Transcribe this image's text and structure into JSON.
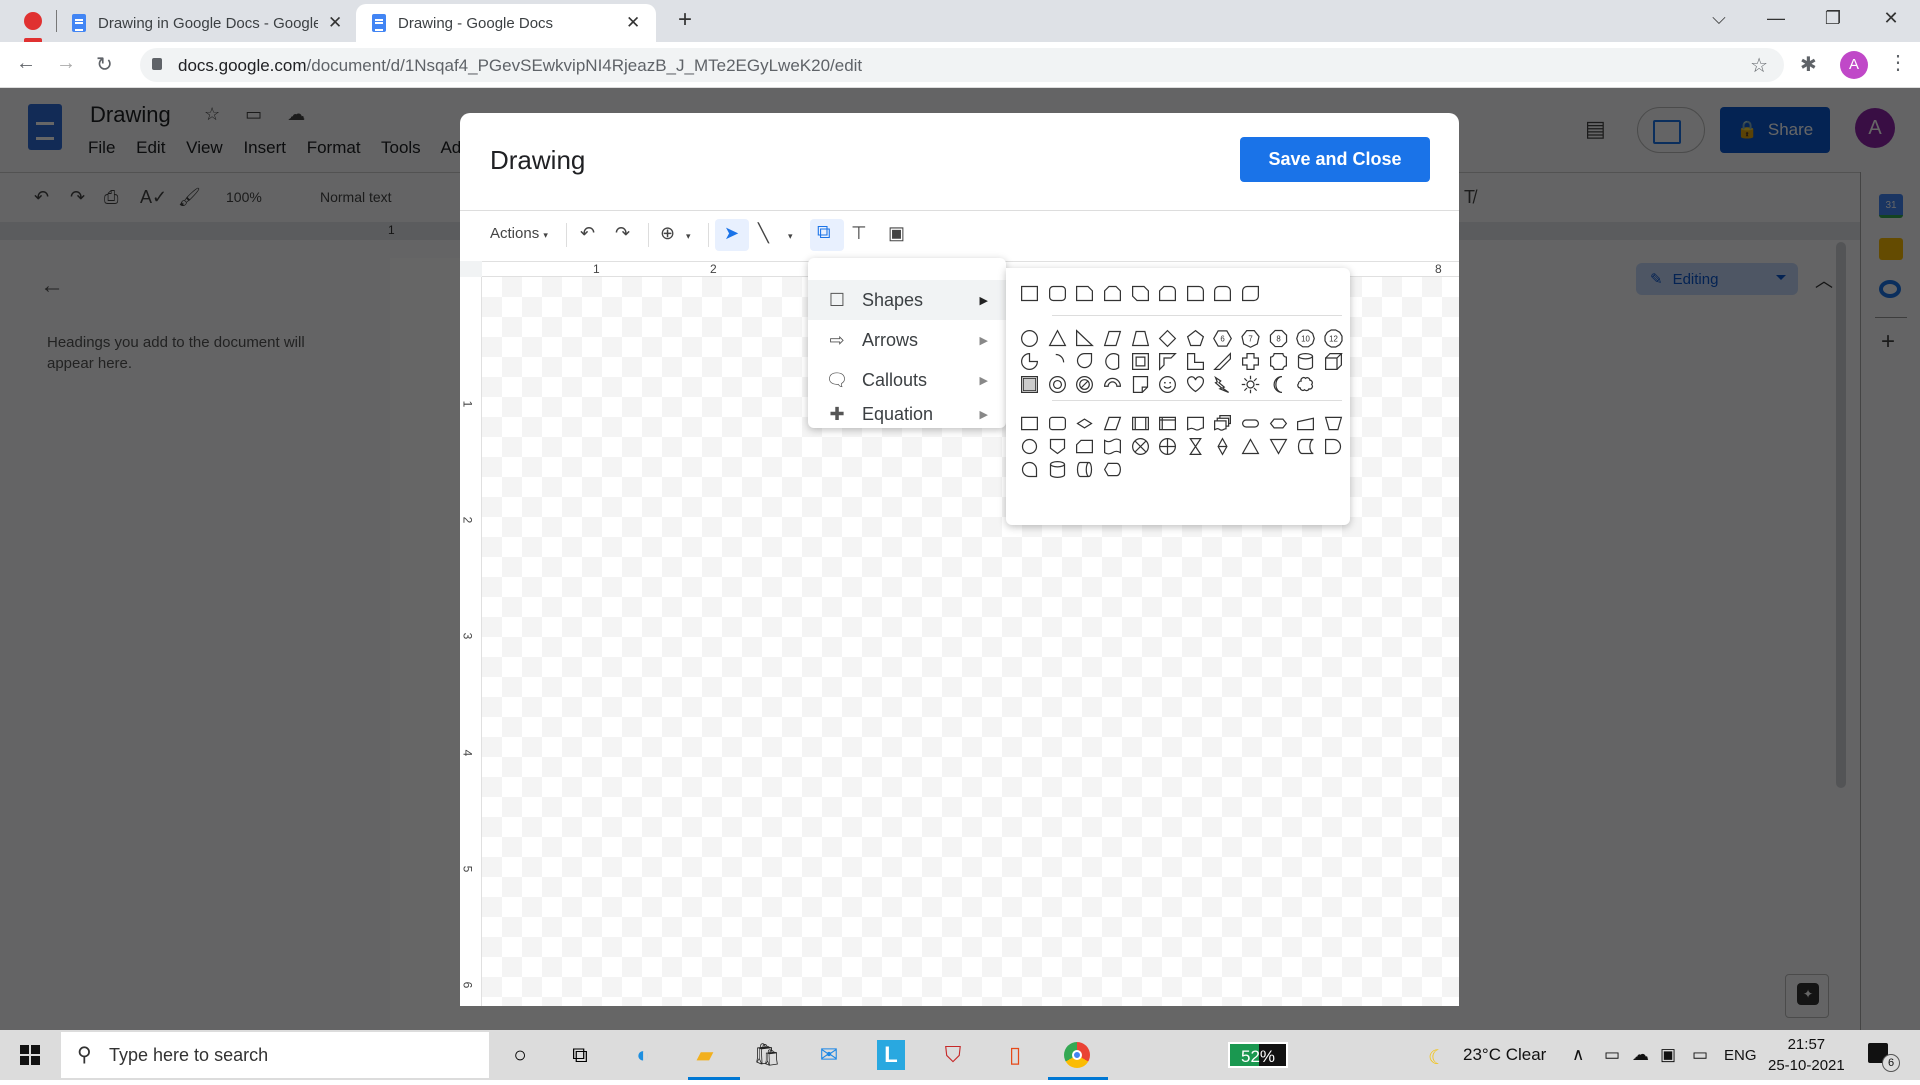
{
  "browser": {
    "tabs": [
      {
        "title": "Drawing in Google Docs - Google",
        "active": false
      },
      {
        "title": "Drawing - Google Docs",
        "active": true
      }
    ],
    "new_tab_label": "+",
    "url_host": "docs.google.com",
    "url_path": "/document/d/1Nsqaf4_PGevSEwkvipNI4RjeazB_J_MTe2EGyLweK20/edit",
    "profile_initial": "A",
    "window_controls": {
      "dropdown": "⌵",
      "minimize": "—",
      "restore": "❐",
      "close": "✕"
    }
  },
  "docs": {
    "title": "Drawing",
    "menu": [
      "File",
      "Edit",
      "View",
      "Insert",
      "Format",
      "Tools",
      "Ad"
    ],
    "zoom": "100%",
    "style": "Normal text",
    "share_label": "Share",
    "user_initial": "A",
    "mode": "Editing",
    "outline_placeholder": "Headings you add to the document will appear here.",
    "calendar_day": "31",
    "ruler_label": "1"
  },
  "dialog": {
    "title": "Drawing",
    "save_label": "Save and Close",
    "toolbar": {
      "actions_label": "Actions",
      "selected_tool": "shape"
    },
    "hruler_labels": [
      "1",
      "2",
      "8"
    ],
    "vruler_labels": [
      "1",
      "2",
      "3",
      "4",
      "5",
      "6"
    ]
  },
  "shape_menu": {
    "items": [
      {
        "label": "Shapes",
        "icon": "square-icon",
        "glyph": "☐",
        "active": true
      },
      {
        "label": "Arrows",
        "icon": "arrow-icon",
        "glyph": "⇨",
        "active": false
      },
      {
        "label": "Callouts",
        "icon": "callout-icon",
        "glyph": "🗨",
        "active": false
      },
      {
        "label": "Equation",
        "icon": "plus-icon",
        "glyph": "✚",
        "active": false
      }
    ],
    "submenu_arrow": "▶"
  },
  "shapes_submenu": {
    "rows": [
      [
        "rectangle",
        "rounded-rectangle",
        "snip-single-corner-rectangle",
        "snip-same-side-corner-rectangle",
        "snip-diagonal-corner-rectangle",
        "snip-round-single-corner-rectangle",
        "round-single-corner-rectangle",
        "round-same-side-corner-rectangle",
        "round-diagonal-corner-rectangle"
      ],
      [
        "oval",
        "triangle",
        "right-triangle",
        "parallelogram",
        "trapezoid",
        "diamond",
        "pentagon",
        "hexagon",
        "heptagon",
        "octagon",
        "decagon",
        "dodecagon"
      ],
      [
        "pie",
        "arc",
        "teardrop",
        "chord",
        "frame",
        "half-frame",
        "corner",
        "diagonal-stripe",
        "plus",
        "plaque",
        "can",
        "cube"
      ],
      [
        "bevel",
        "donut",
        "no-symbol",
        "block-arc",
        "folded-corner",
        "smiley-face",
        "heart",
        "lightning-bolt",
        "sun",
        "moon",
        "cloud"
      ],
      [
        "flowchart-process",
        "flowchart-alternate-process",
        "flowchart-decision",
        "flowchart-data",
        "flowchart-predefined-process",
        "flowchart-internal-storage",
        "flowchart-document",
        "flowchart-multidocument",
        "flowchart-terminator",
        "flowchart-preparation",
        "flowchart-manual-input",
        "flowchart-manual-operation"
      ],
      [
        "flowchart-connector",
        "flowchart-offpage-connector",
        "flowchart-card",
        "flowchart-punched-tape",
        "flowchart-summing-junction",
        "flowchart-or",
        "flowchart-collate",
        "flowchart-sort",
        "flowchart-extract",
        "flowchart-merge",
        "flowchart-stored-data",
        "flowchart-delay"
      ],
      [
        "flowchart-sequential-access-storage",
        "flowchart-magnetic-disk",
        "flowchart-direct-access-storage",
        "flowchart-display"
      ]
    ],
    "polygon_numbers": [
      "6",
      "7",
      "8",
      "10",
      "12"
    ]
  },
  "taskbar": {
    "search_placeholder": "Type here to search",
    "apps": [
      "cortana",
      "task-view",
      "edge",
      "file-explorer",
      "microsoft-store",
      "mail",
      "l-app",
      "mcafee",
      "office",
      "chrome"
    ],
    "battery_percent": 52,
    "battery_label": "52%",
    "weather": "23°C  Clear",
    "language": "ENG",
    "time": "21:57",
    "date": "25-10-2021",
    "notification_count": "6"
  },
  "colors": {
    "accent": "#1a73e8",
    "share": "#0b57d0",
    "profile": "#c048c8"
  }
}
